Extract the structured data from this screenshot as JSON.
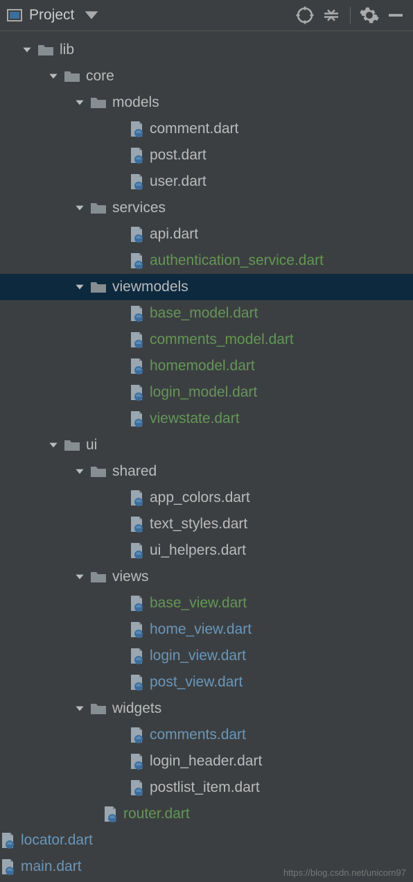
{
  "toolbar": {
    "title": "Project"
  },
  "watermark": "https://blog.csdn.net/unicorn97",
  "tree": [
    {
      "type": "folder",
      "level": 0,
      "label": "lib",
      "color": "c-folder",
      "expanded": true
    },
    {
      "type": "folder",
      "level": 1,
      "label": "core",
      "color": "c-folder",
      "expanded": true
    },
    {
      "type": "folder",
      "level": 2,
      "label": "models",
      "color": "c-folder",
      "expanded": true
    },
    {
      "type": "file",
      "level": 3,
      "label": "comment.dart",
      "color": "c-default"
    },
    {
      "type": "file",
      "level": 3,
      "label": "post.dart",
      "color": "c-default"
    },
    {
      "type": "file",
      "level": 3,
      "label": "user.dart",
      "color": "c-default"
    },
    {
      "type": "folder",
      "level": 2,
      "label": "services",
      "color": "c-folder",
      "expanded": true
    },
    {
      "type": "file",
      "level": 3,
      "label": "api.dart",
      "color": "c-default"
    },
    {
      "type": "file",
      "level": 3,
      "label": "authentication_service.dart",
      "color": "c-green"
    },
    {
      "type": "folder",
      "level": 2,
      "label": "viewmodels",
      "color": "c-folder",
      "expanded": true,
      "selected": true
    },
    {
      "type": "file",
      "level": 3,
      "label": "base_model.dart",
      "color": "c-green"
    },
    {
      "type": "file",
      "level": 3,
      "label": "comments_model.dart",
      "color": "c-green"
    },
    {
      "type": "file",
      "level": 3,
      "label": "homemodel.dart",
      "color": "c-green"
    },
    {
      "type": "file",
      "level": 3,
      "label": "login_model.dart",
      "color": "c-green"
    },
    {
      "type": "file",
      "level": 3,
      "label": "viewstate.dart",
      "color": "c-green"
    },
    {
      "type": "folder",
      "level": 1,
      "label": "ui",
      "color": "c-folder",
      "expanded": true
    },
    {
      "type": "folder",
      "level": 2,
      "label": "shared",
      "color": "c-folder",
      "expanded": true
    },
    {
      "type": "file",
      "level": 3,
      "label": "app_colors.dart",
      "color": "c-default"
    },
    {
      "type": "file",
      "level": 3,
      "label": "text_styles.dart",
      "color": "c-default"
    },
    {
      "type": "file",
      "level": 3,
      "label": "ui_helpers.dart",
      "color": "c-default"
    },
    {
      "type": "folder",
      "level": 2,
      "label": "views",
      "color": "c-folder",
      "expanded": true
    },
    {
      "type": "file",
      "level": 3,
      "label": "base_view.dart",
      "color": "c-green"
    },
    {
      "type": "file",
      "level": 3,
      "label": "home_view.dart",
      "color": "c-blue"
    },
    {
      "type": "file",
      "level": 3,
      "label": "login_view.dart",
      "color": "c-blue"
    },
    {
      "type": "file",
      "level": 3,
      "label": "post_view.dart",
      "color": "c-blue"
    },
    {
      "type": "folder",
      "level": 2,
      "label": "widgets",
      "color": "c-folder",
      "expanded": true
    },
    {
      "type": "file",
      "level": 3,
      "label": "comments.dart",
      "color": "c-blue"
    },
    {
      "type": "file",
      "level": 3,
      "label": "login_header.dart",
      "color": "c-default"
    },
    {
      "type": "file",
      "level": 3,
      "label": "postlist_item.dart",
      "color": "c-default"
    },
    {
      "type": "file",
      "level": 2,
      "label": "router.dart",
      "color": "c-green"
    },
    {
      "type": "file",
      "level": 1,
      "label": "locator.dart",
      "color": "c-blue"
    },
    {
      "type": "file",
      "level": 1,
      "label": "main.dart",
      "color": "c-blue"
    }
  ]
}
